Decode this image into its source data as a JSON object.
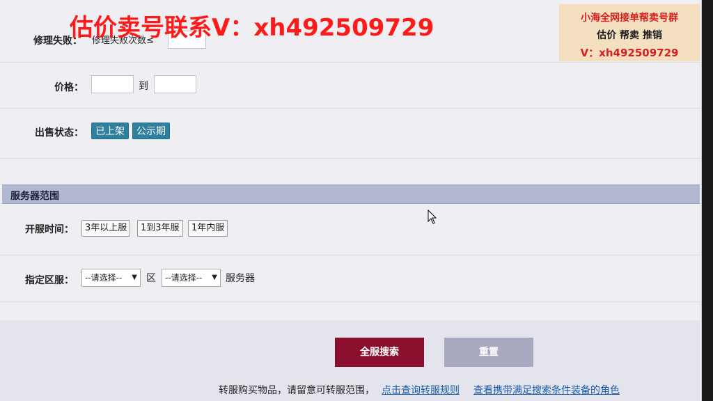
{
  "repair": {
    "label": "修理失败：",
    "desc": "修理失败次数≤"
  },
  "price": {
    "label": "价格：",
    "to": "到"
  },
  "sale_status": {
    "label": "出售状态：",
    "options": [
      "已上架",
      "公示期"
    ]
  },
  "server_section": {
    "title": "服务器范围"
  },
  "open_time": {
    "label": "开服时间：",
    "options": [
      "3年以上服",
      "1到3年服",
      "1年内服"
    ]
  },
  "zone": {
    "label": "指定区服：",
    "select1": "--请选择--",
    "mid": "区",
    "select2": "--请选择--",
    "suffix": "服务器"
  },
  "actions": {
    "search": "全服搜索",
    "reset": "重置"
  },
  "footer": {
    "note": "转服购买物品，请留意可转服范围，",
    "link1": "点击查询转服规则",
    "link2": "查看携带满足搜索条件装备的角色"
  },
  "watermark": {
    "main": "估价卖号联系V：xh492509729",
    "box_line1": "小海全网接单帮卖号群",
    "box_line2": "估价 帮卖 推销",
    "box_line3": "V：xh492509729"
  },
  "colors": {
    "sale_tag": "#2f7f9e",
    "search_button": "#8a0f2c",
    "reset_button": "#a8a8c0",
    "section_bar": "#b3b8d2"
  }
}
